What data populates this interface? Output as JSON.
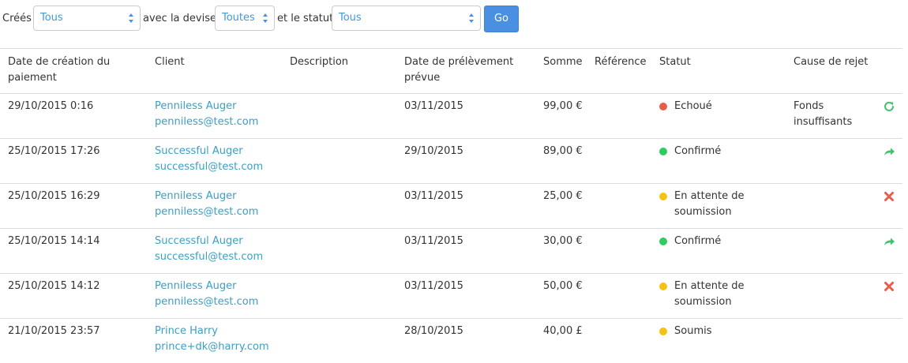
{
  "filters": {
    "created_label": "Créés",
    "created_value": "Tous",
    "currency_label": "avec la devise",
    "currency_value": "Toutes",
    "status_label": "et le statut",
    "status_value": "Tous",
    "go_label": "Go"
  },
  "table": {
    "headers": {
      "date": "Date de création du paiement",
      "client": "Client",
      "description": "Description",
      "charge_date": "Date de prélèvement prévue",
      "amount": "Somme",
      "reference": "Référence",
      "status": "Statut",
      "reject": "Cause de rejet"
    },
    "rows": [
      {
        "date": "29/10/2015 0:16",
        "name": "Penniless Auger",
        "email": "penniless@test.com",
        "charge_date": "03/11/2015",
        "amount": "99,00 €",
        "status": "Echoué",
        "status_color": "#e85c4a",
        "reject": "Fonds insuffisants",
        "action_icon": "retry-icon",
        "action_color": "#3fc36b"
      },
      {
        "date": "25/10/2015 17:26",
        "name": "Successful Auger",
        "email": "successful@test.com",
        "charge_date": "29/10/2015",
        "amount": "89,00 €",
        "status": "Confirmé",
        "status_color": "#2ecc5f",
        "reject": "",
        "action_icon": "forward-icon",
        "action_color": "#3fc36b"
      },
      {
        "date": "25/10/2015 16:29",
        "name": "Penniless Auger",
        "email": "penniless@test.com",
        "charge_date": "03/11/2015",
        "amount": "25,00 €",
        "status": "En attente de soumission",
        "status_color": "#f5c211",
        "reject": "",
        "action_icon": "cancel-icon",
        "action_color": "#e85c4a"
      },
      {
        "date": "25/10/2015 14:14",
        "name": "Successful Auger",
        "email": "successful@test.com",
        "charge_date": "03/11/2015",
        "amount": "30,00 €",
        "status": "Confirmé",
        "status_color": "#2ecc5f",
        "reject": "",
        "action_icon": "forward-icon",
        "action_color": "#3fc36b"
      },
      {
        "date": "25/10/2015 14:12",
        "name": "Penniless Auger",
        "email": "penniless@test.com",
        "charge_date": "03/11/2015",
        "amount": "50,00 €",
        "status": "En attente de soumission",
        "status_color": "#f5c211",
        "reject": "",
        "action_icon": "cancel-icon",
        "action_color": "#e85c4a"
      },
      {
        "date": "21/10/2015 23:57",
        "name": "Prince Harry",
        "email": "prince+dk@harry.com",
        "charge_date": "28/10/2015",
        "amount": "40,00 £",
        "status": "Soumis",
        "status_color": "#f5c211",
        "reject": "",
        "action_icon": "",
        "action_color": ""
      }
    ]
  }
}
